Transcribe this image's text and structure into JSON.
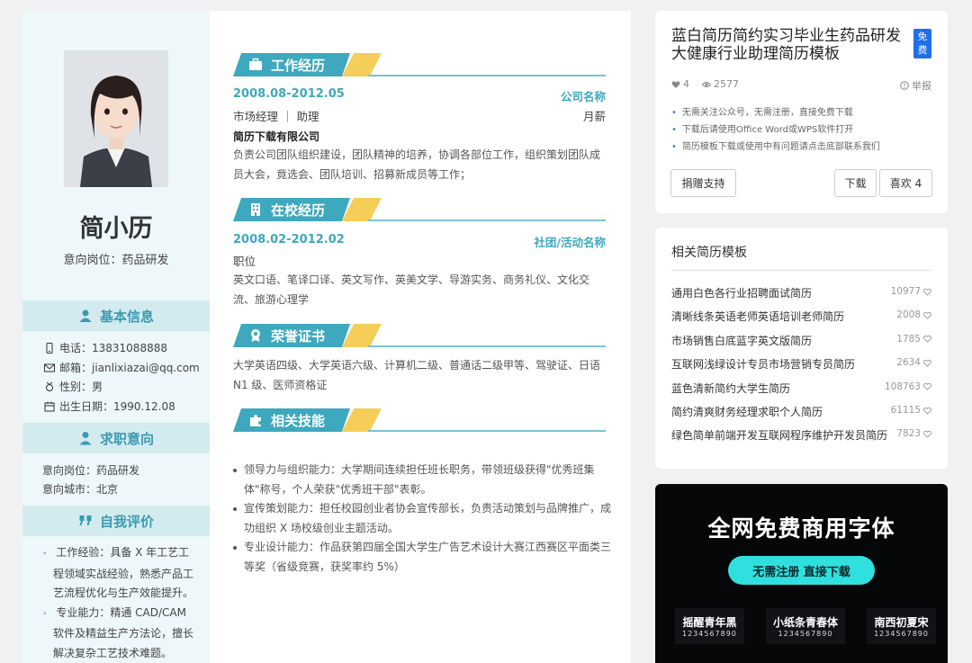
{
  "resume": {
    "name": "简小历",
    "intent_line": "意向岗位：药品研发",
    "sections_side": {
      "basic": "基本信息",
      "job": "求职意向",
      "self": "自我评价"
    },
    "basic_info": {
      "phone": "电话：13831088888",
      "email": "邮箱：jianlixiazai@qq.com",
      "gender": "性别：男",
      "birth": "出生日期：1990.12.08"
    },
    "job_intent": {
      "position": "意向岗位：药品研发",
      "city": "意向城市：北京"
    },
    "self_eval": [
      "工作经验：具备 X 年工艺工程领域实战经验，熟悉产品工艺流程优化与生产效能提升。",
      "专业能力：精通 CAD/CAM 软件及精益生产方法论，擅长解决复杂工艺技术难题。"
    ],
    "work": {
      "title": "工作经历",
      "date": "2008.08-2012.05",
      "company_label": "公司名称",
      "role": "市场经理 ｜ 助理",
      "salary": "月薪",
      "company": "简历下载有限公司",
      "desc": "负责公司团队组织建设，团队精神的培养，协调各部位工作，组织策划团队成员大会，竟选会、团队培训、招募新成员等工作；"
    },
    "school": {
      "title": "在校经历",
      "date": "2008.02-2012.02",
      "org_label": "社团/活动名称",
      "role": "职位",
      "desc": "英文口语、笔译口译、英文写作、英美文学、导游实务、商务礼仪、文化交流、旅游心理学"
    },
    "honor": {
      "title": "荣誉证书",
      "desc": "大学英语四级、大学英语六级、计算机二级、普通话二级甲等、驾驶证、日语 N1 级、医师资格证"
    },
    "skills": {
      "title": "相关技能",
      "items": [
        "领导力与组织能力：大学期间连续担任班长职务，带领班级获得\"优秀班集体\"称号，个人荣获\"优秀班干部\"表彰。",
        "宣传策划能力：担任校园创业者协会宣传部长，负责活动策划与品牌推广，成功组织 X 场校级创业主题活动。",
        "专业设计能力：作品获第四届全国大学生广告艺术设计大赛江西赛区平面类三等奖（省级竞赛，获奖率约 5%）"
      ]
    }
  },
  "detail": {
    "title": "蓝白简历简约实习毕业生药品研发大健康行业助理简历模板",
    "free_badge": "免费",
    "likes": "4",
    "views": "2577",
    "report": "举报",
    "tips": [
      "无需关注公众号，无需注册，直接免费下载",
      "下载后请使用Office Word或WPS软件打开",
      "简历模板下载或使用中有问题请点击底部联系我们"
    ],
    "donate": "捐赠支持",
    "download": "下载",
    "like_btn": "喜欢 4"
  },
  "related": {
    "title": "相关简历模板",
    "items": [
      {
        "t": "通用白色各行业招聘面试简历",
        "n": "10977"
      },
      {
        "t": "清晰线条英语老师英语培训老师简历",
        "n": "2008"
      },
      {
        "t": "市场销售白底蓝字英文版简历",
        "n": "1785"
      },
      {
        "t": "互联网浅绿设计专员市场营销专员简历",
        "n": "2634"
      },
      {
        "t": "蓝色清新简约大学生简历",
        "n": "108763"
      },
      {
        "t": "简约清爽财务经理求职个人简历",
        "n": "61115"
      },
      {
        "t": "绿色简单前端开发互联网程序维护开发员简历",
        "n": "7823"
      }
    ]
  },
  "ad": {
    "headline": "全网免费商用字体",
    "cta": "无需注册 直接下载",
    "fonts": [
      {
        "a": "摇醒青年黑",
        "b": "1234567890"
      },
      {
        "a": "小纸条青春体",
        "b": "1234567890"
      },
      {
        "a": "南西初夏宋",
        "b": "1234567890"
      }
    ]
  },
  "colors": {
    "accent": "#3ea8be",
    "yellow": "#f5cd59",
    "side_bg": "#eef7f9",
    "badge": "#1e6fe8",
    "ad_cta": "#2fe0df"
  }
}
